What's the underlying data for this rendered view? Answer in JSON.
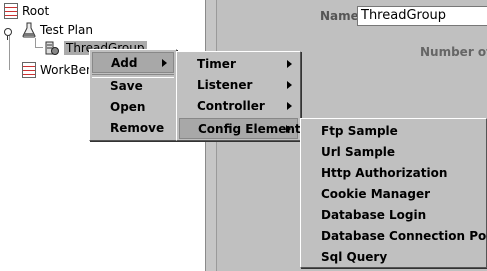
{
  "tree": {
    "root": "Root",
    "test_plan": "Test Plan",
    "thread_group": "ThreadGroup",
    "workbench": "WorkBench"
  },
  "form": {
    "name_label": "Name",
    "name_value": "ThreadGroup",
    "number_label": "Number of T"
  },
  "context_menu": {
    "items": [
      "Add",
      "Save",
      "Open",
      "Remove"
    ]
  },
  "add_submenu": {
    "items": [
      "Timer",
      "Listener",
      "Controller",
      "Config Element"
    ]
  },
  "config_submenu": {
    "items": [
      "Ftp Sample",
      "Url Sample",
      "Http Authorization",
      "Cookie Manager",
      "Database Login",
      "Database Connection Pool",
      "Sql Query"
    ]
  },
  "colors": {
    "menu_bg": "#c0c0c0",
    "highlight": "#a8a8a8",
    "tree_bg": "#ffffff"
  }
}
